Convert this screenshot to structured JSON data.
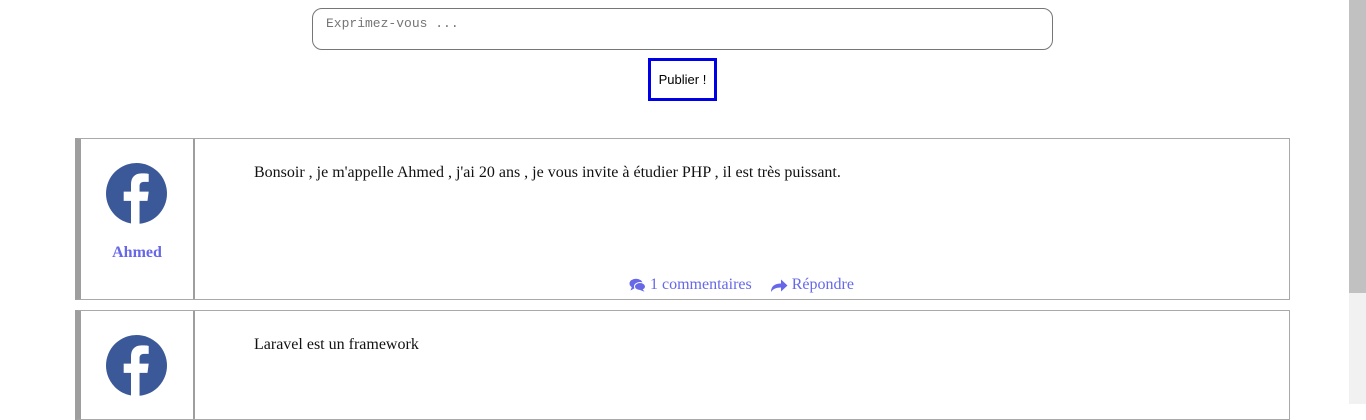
{
  "composer": {
    "placeholder": "Exprimez-vous ...",
    "publish_label": "Publier !"
  },
  "posts": [
    {
      "author": "Ahmed",
      "avatar_icon": "facebook-icon",
      "text": "Bonsoir , je m'appelle Ahmed , j'ai 20 ans , je vous invite à étudier PHP , il est très puissant.",
      "comments_label": "1 commentaires",
      "reply_label": "Répondre"
    },
    {
      "avatar_icon": "facebook-icon",
      "text": "Laravel est un framework"
    }
  ],
  "colors": {
    "accent": "#6668e8",
    "facebook_blue": "#3b5998",
    "button_border": "#0000e6"
  }
}
